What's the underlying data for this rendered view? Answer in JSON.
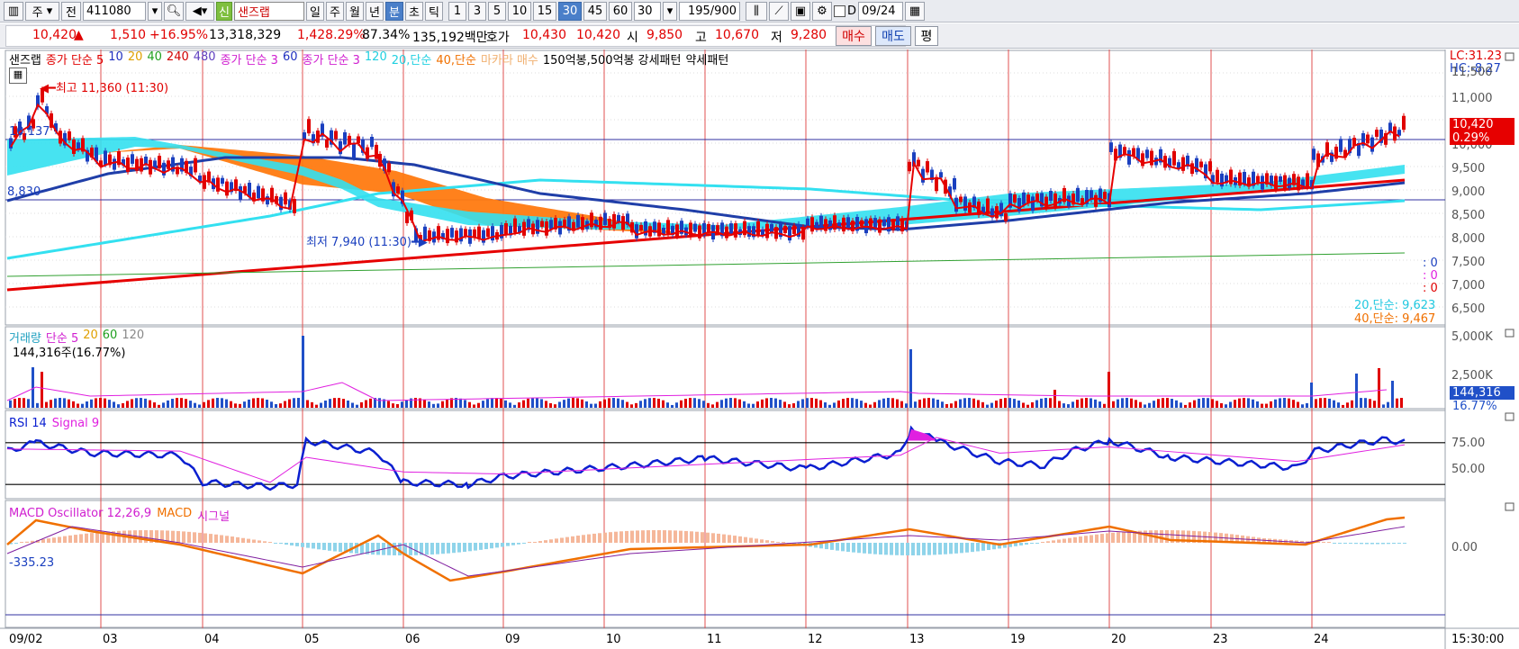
{
  "toolbar": {
    "stock_type": "주",
    "stock_range": "전",
    "stock_code": "411080",
    "stock_name": "샌즈랩",
    "name_badge": "신",
    "periods": [
      "일",
      "주",
      "월",
      "년",
      "분",
      "초",
      "틱"
    ],
    "active_period": "분",
    "intervals": [
      "1",
      "3",
      "5",
      "10",
      "15",
      "30",
      "45",
      "60"
    ],
    "active_interval": "30",
    "interval_select": "30",
    "count": "195/900",
    "date": "09/24",
    "date_prefix": "D"
  },
  "quote": {
    "price": "10,420",
    "change_arrow": "▲",
    "change": "1,510",
    "change_pct": "+16.95%",
    "volume": "13,318,329",
    "volume_ratio": "1,428.29%",
    "turnover_rate": "87.34%",
    "amount": "135,192백만",
    "bid_label": "호가",
    "ask": "10,430",
    "bid": "10,420",
    "open_label": "시",
    "open": "9,850",
    "high_label": "고",
    "high": "10,670",
    "low_label": "저",
    "low": "9,280",
    "buy_label": "매수",
    "sell_label": "매도",
    "avg_label": "평"
  },
  "colors": {
    "up": "#e00000",
    "down": "#1a3fbf",
    "ma_blue": "#1f3ea8",
    "ma_cyan": "#33e0f0",
    "cloud_orange": "#ff7a10",
    "trend_red": "#e60000",
    "rsi": "#0a1fd0",
    "signal": "#e020e0",
    "macd": "#f07000"
  },
  "price_panel": {
    "legend": [
      {
        "text": "샌즈랩",
        "color": "#000"
      },
      {
        "text": "종가 단순 5",
        "color": "#e00000"
      },
      {
        "text": "10",
        "color": "#2030c0"
      },
      {
        "text": "20",
        "color": "#e0a000"
      },
      {
        "text": "40",
        "color": "#20a020"
      },
      {
        "text": "240",
        "color": "#d00000"
      },
      {
        "text": "480",
        "color": "#6040c0"
      },
      {
        "text": "종가 단순 3",
        "color": "#d020d0"
      },
      {
        "text": "60",
        "color": "#2030c0"
      },
      {
        "text": "종가 단순 3",
        "color": "#d020d0"
      },
      {
        "text": "120",
        "color": "#20d0e0"
      },
      {
        "text": "20,단순",
        "color": "#20d0e0"
      },
      {
        "text": "40,단순",
        "color": "#f07000"
      },
      {
        "text": "마카라 매수",
        "color": "#f0b070"
      },
      {
        "text": "150억봉,500억봉 강세패턴",
        "color": "#000"
      },
      {
        "text": "약세패턴",
        "color": "#000"
      }
    ],
    "high_annotation": "최고 11,360 (11:30)",
    "low_annotation": "최저 7,940 (11:30)",
    "left_value_1": "10,137",
    "left_value_2": "8,830",
    "lc": "LC:31.23",
    "hc": "HC:-8.27",
    "y_ticks": [
      "11,500",
      "11,000",
      "10,000",
      "9,500",
      "9,000",
      "8,500",
      "8,000",
      "7,500",
      "7,000",
      "6,500"
    ],
    "current_price_tag": "10,420",
    "current_pct_tag": "0.29%",
    "zero_values": [
      ": 0",
      ": 0",
      ": 0"
    ],
    "ma20_text": "20,단순: 9,623",
    "ma40_text": "40,단순: 9,467"
  },
  "volume_panel": {
    "legend": [
      {
        "text": "거래량",
        "color": "#20a0c0"
      },
      {
        "text": "단순 5",
        "color": "#d020d0"
      },
      {
        "text": "20",
        "color": "#e0a000"
      },
      {
        "text": "60",
        "color": "#20a020"
      },
      {
        "text": "120",
        "color": "#888"
      }
    ],
    "current_text": "144,316주(16.77%)",
    "y_ticks": [
      "5,000K",
      "2,500K"
    ],
    "tag_value": "144,316",
    "tag_pct": "16.77%"
  },
  "rsi_panel": {
    "legend": [
      {
        "text": "RSI 14",
        "color": "#0a1fd0"
      },
      {
        "text": "Signal 9",
        "color": "#e020e0"
      }
    ],
    "y_ticks": [
      "75.00",
      "50.00"
    ]
  },
  "macd_panel": {
    "legend": [
      {
        "text": "MACD Oscillator 12,26,9",
        "color": "#d020d0"
      },
      {
        "text": "MACD",
        "color": "#f07000"
      },
      {
        "text": "시그널",
        "color": "#d020d0"
      }
    ],
    "left_value": "-335.23",
    "y_ticks": [
      "0.00"
    ]
  },
  "x_axis": {
    "labels": [
      "09/02",
      "03",
      "04",
      "05",
      "06",
      "09",
      "10",
      "11",
      "12",
      "13",
      "19",
      "20",
      "23",
      "24"
    ],
    "time": "15:30:00"
  }
}
